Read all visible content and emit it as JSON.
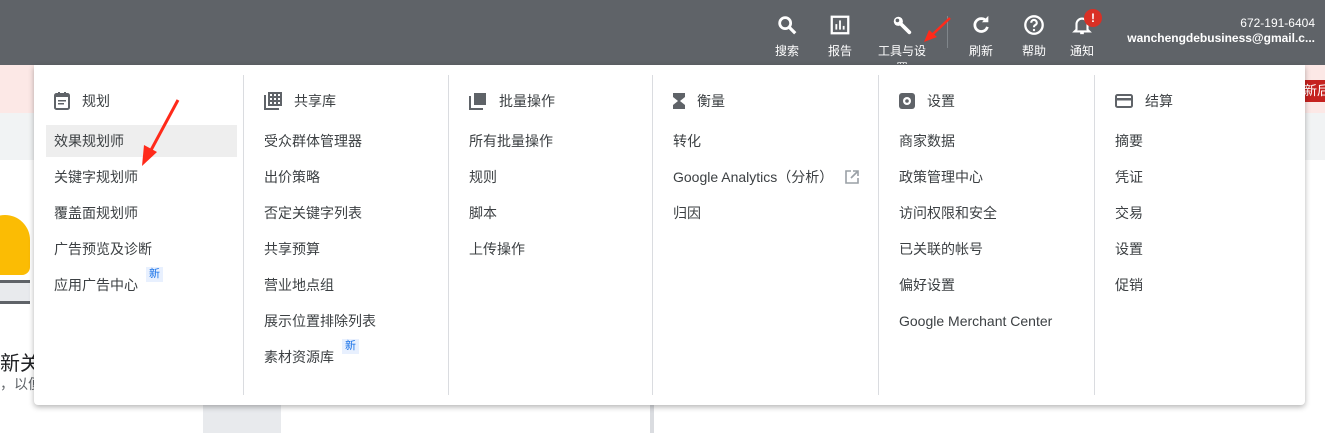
{
  "topbar": {
    "buttons": [
      {
        "label": "搜索",
        "icon": "search-icon"
      },
      {
        "label": "报告",
        "icon": "report-icon"
      },
      {
        "label": "工具与设置",
        "icon": "wrench-icon"
      },
      {
        "label": "刷新",
        "icon": "refresh-icon"
      },
      {
        "label": "帮助",
        "icon": "help-icon"
      },
      {
        "label": "通知",
        "icon": "bell-icon"
      }
    ],
    "notification_badge": "!",
    "account_id": "672-191-6404",
    "account_email": "wanchengdebusiness@gmail.c..."
  },
  "background": {
    "banner_tag": "新后",
    "heading_fragment": "新关",
    "text_fragment": "，以便"
  },
  "menu": {
    "new_badge": "新",
    "columns": [
      {
        "title": "规划",
        "items": [
          "效果规划师",
          "关键字规划师",
          "覆盖面规划师",
          "广告预览及诊断",
          "应用广告中心"
        ]
      },
      {
        "title": "共享库",
        "items": [
          "受众群体管理器",
          "出价策略",
          "否定关键字列表",
          "共享预算",
          "营业地点组",
          "展示位置排除列表",
          "素材资源库"
        ]
      },
      {
        "title": "批量操作",
        "items": [
          "所有批量操作",
          "规则",
          "脚本",
          "上传操作"
        ]
      },
      {
        "title": "衡量",
        "items": [
          "转化",
          "Google Analytics（分析）",
          "归因"
        ]
      },
      {
        "title": "设置",
        "items": [
          "商家数据",
          "政策管理中心",
          "访问权限和安全",
          "已关联的帐号",
          "偏好设置",
          "Google Merchant Center"
        ]
      },
      {
        "title": "结算",
        "items": [
          "摘要",
          "凭证",
          "交易",
          "设置",
          "促销"
        ]
      }
    ]
  },
  "colors": {
    "topbar": "#5f6368",
    "banner": "#fce8e6",
    "badge": "#d93025",
    "new_badge": "#1a73e8",
    "annotation": "#ff2a1a"
  }
}
